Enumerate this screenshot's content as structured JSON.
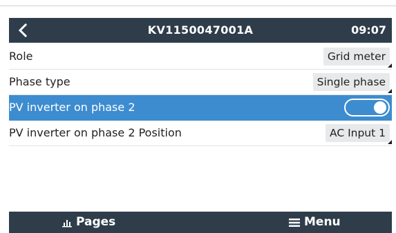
{
  "header": {
    "title": "KV1150047001A",
    "time": "09:07",
    "back_icon": "chevron-left-icon"
  },
  "settings": [
    {
      "label": "Role",
      "value": "Grid meter",
      "type": "dropdown"
    },
    {
      "label": "Phase type",
      "value": "Single phase",
      "type": "dropdown"
    },
    {
      "label": "PV inverter on phase 2",
      "type": "switch",
      "on": true,
      "selected": true
    },
    {
      "label": "PV inverter on phase 2 Position",
      "value": "AC Input 1",
      "type": "dropdown"
    }
  ],
  "footer": {
    "pages_label": "Pages",
    "pages_icon": "bar-chart-icon",
    "menu_label": "Menu",
    "menu_icon": "hamburger-menu-icon"
  },
  "colors": {
    "header_bg": "#2f3d4b",
    "selected_bg": "#3d8cd0",
    "value_bg": "#e8e9ea"
  }
}
